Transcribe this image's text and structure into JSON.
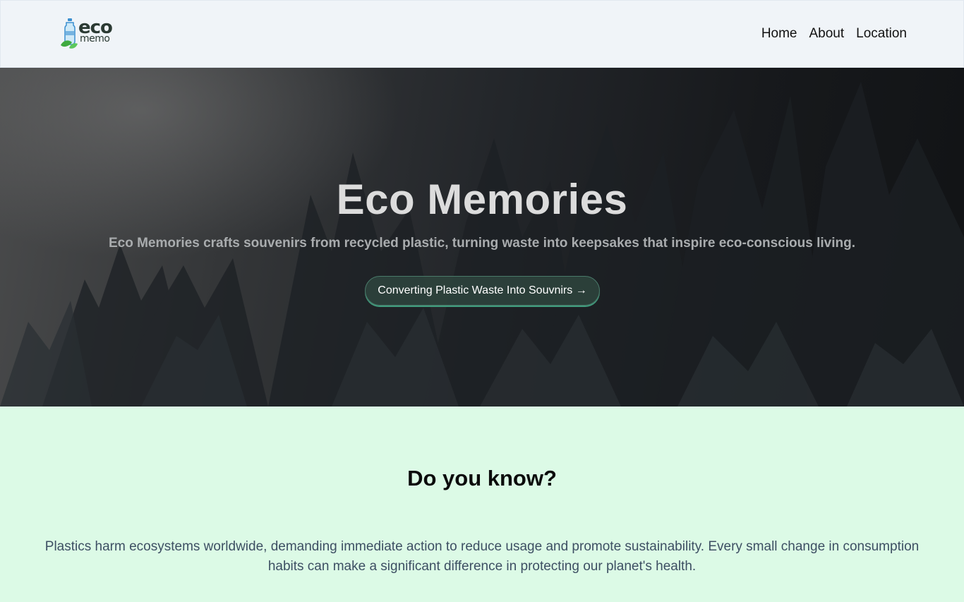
{
  "header": {
    "logo": {
      "primary": "eco",
      "secondary": "memo"
    },
    "nav": [
      {
        "label": "Home"
      },
      {
        "label": "About"
      },
      {
        "label": "Location"
      }
    ]
  },
  "hero": {
    "title": "Eco Memories",
    "subtitle": "Eco Memories crafts souvenirs from recycled plastic, turning waste into keepsakes that inspire eco-conscious living.",
    "cta_label": "Converting Plastic Waste Into Souvnirs →"
  },
  "info": {
    "title": "Do you know?",
    "text": "Plastics harm ecosystems worldwide, demanding immediate action to reduce usage and promote sustainability. Every small change in consumption habits can make a significant difference in protecting our planet's health."
  },
  "colors": {
    "navbar_bg": "#f0f4f8",
    "section_bg": "#dcfae6",
    "cta_bg": "#2c423c",
    "cta_border": "#3f9b7c"
  },
  "icons": {
    "logo": "plastic-bottle-with-leaf-icon",
    "cta_arrow": "right-arrow"
  }
}
